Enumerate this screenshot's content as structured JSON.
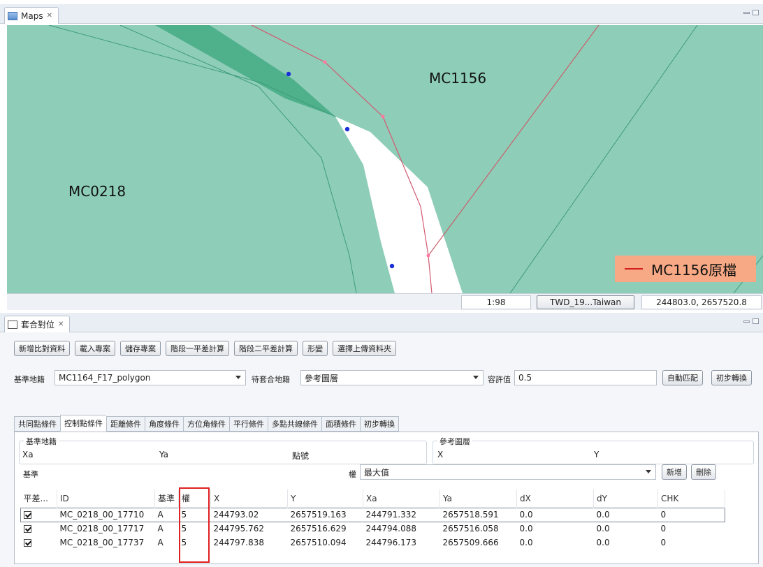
{
  "maps_view": {
    "tab_title": "Maps"
  },
  "map": {
    "parcels": [
      "MC1156",
      "MC0218"
    ],
    "legend_label": "MC1156原檔",
    "colors": {
      "land": "#8ecdb8",
      "overlap": "#4fb08c",
      "gap": "#ffffff",
      "outline": "#d35a72",
      "vertex": "#1a2fd6"
    }
  },
  "status": {
    "scale": "1:98",
    "crs": "TWD_19...Taiwan",
    "coords": "244803.0, 2657520.8"
  },
  "panel": {
    "tab_title": "套合對位"
  },
  "toolbar": [
    "新增比對資料",
    "載入專案",
    "儲存專案",
    "階段一平差計算",
    "階段二平差計算",
    "形變",
    "選擇上傳資料夾"
  ],
  "settings": {
    "base_label": "基準地籍",
    "base_value": "MC1164_F17_polygon",
    "target_label": "待套合地籍",
    "target_value": "參考圖層",
    "tolerance_label": "容許值",
    "tolerance_value": "0.5",
    "auto_match": "自動匹配",
    "initial_transform": "初步轉換"
  },
  "condition_tabs": [
    "共同點條件",
    "控制點條件",
    "距離條件",
    "角度條件",
    "方位角條件",
    "平行條件",
    "多點共線條件",
    "面積條件",
    "初步轉換"
  ],
  "active_condition_tab": "控制點條件",
  "base_group": {
    "title": "基準地籍",
    "xa": "Xa",
    "ya": "Ya",
    "point_no": "點號"
  },
  "ref_group": {
    "title": "參考圖層",
    "x": "X",
    "y": "Y"
  },
  "weight_row": {
    "base_label": "基準",
    "weight_label": "權",
    "weight_value": "最大值",
    "add": "新增",
    "delete": "刪除"
  },
  "table": {
    "headers": [
      "平差...",
      "ID",
      "基準",
      "權",
      "X",
      "Y",
      "Xa",
      "Ya",
      "dX",
      "dY",
      "CHK"
    ],
    "rows": [
      {
        "checked": true,
        "id": "MC_0218_00_17710",
        "base": "A",
        "weight": "5",
        "x": "244793.02",
        "y": "2657519.163",
        "xa": "244791.332",
        "ya": "2657518.591",
        "dx": "0.0",
        "dy": "0.0",
        "chk": "0"
      },
      {
        "checked": true,
        "id": "MC_0218_00_17717",
        "base": "A",
        "weight": "5",
        "x": "244795.762",
        "y": "2657516.629",
        "xa": "244794.088",
        "ya": "2657516.058",
        "dx": "0.0",
        "dy": "0.0",
        "chk": "0"
      },
      {
        "checked": true,
        "id": "MC_0218_00_17737",
        "base": "A",
        "weight": "5",
        "x": "244797.838",
        "y": "2657510.094",
        "xa": "244796.173",
        "ya": "2657509.666",
        "dx": "0.0",
        "dy": "0.0",
        "chk": "0"
      }
    ]
  }
}
